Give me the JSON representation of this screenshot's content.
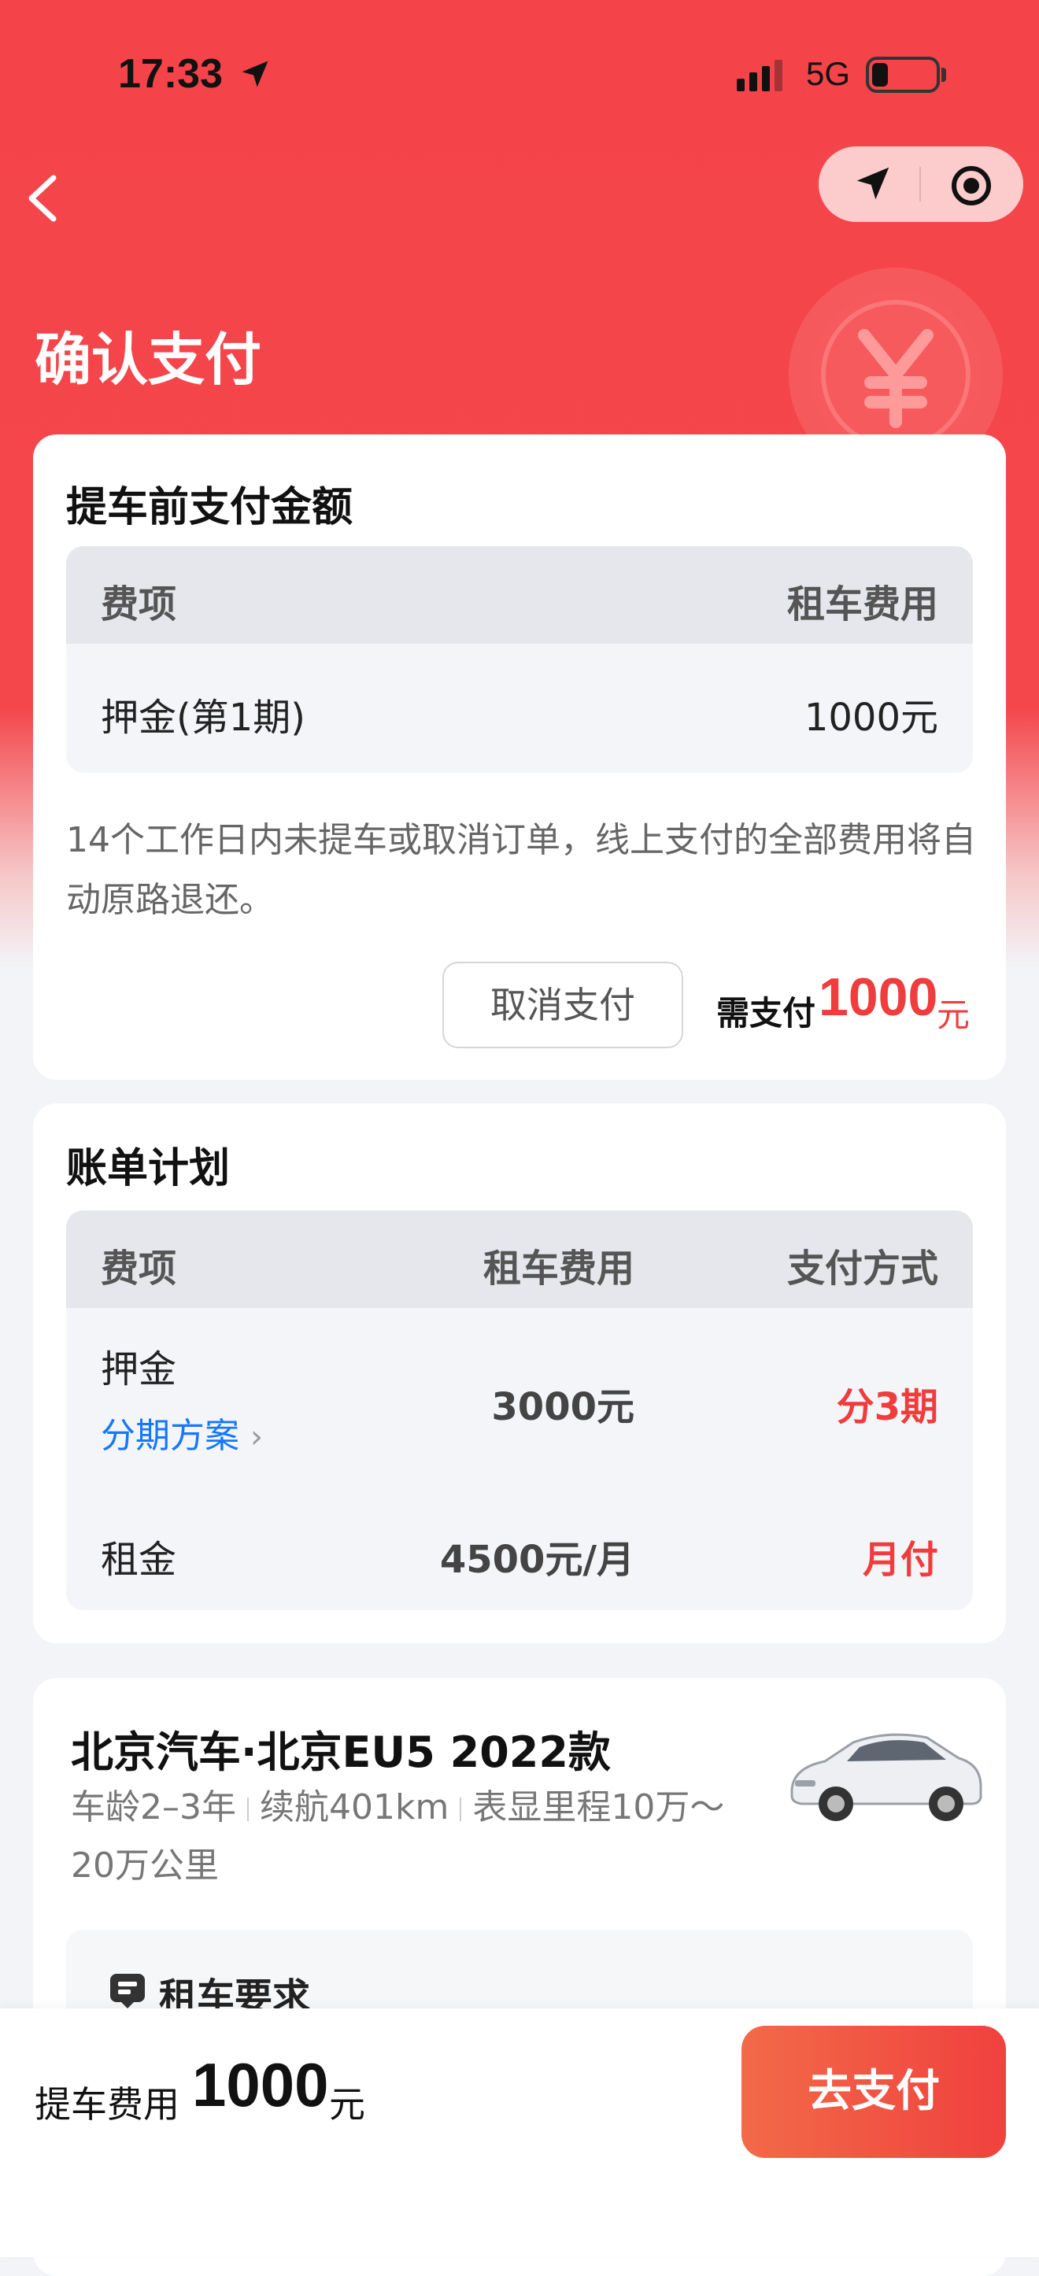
{
  "status_bar": {
    "time": "17:33",
    "network": "5G"
  },
  "header": {
    "title": "确认支付"
  },
  "pre_pickup": {
    "title": "提车前支付金额",
    "columns": [
      "费项",
      "租车费用"
    ],
    "rows": [
      {
        "item": "押金(第1期)",
        "amount": "1000元"
      }
    ],
    "note": "14个工作日内未提车或取消订单，线上支付的全部费用将自动原路退还。",
    "cancel_label": "取消支付",
    "need_pay_label": "需支付",
    "need_pay_amount": "1000",
    "need_pay_unit": "元"
  },
  "bill_plan": {
    "title": "账单计划",
    "columns": [
      "费项",
      "租车费用",
      "支付方式"
    ],
    "rows": [
      {
        "item": "押金",
        "link": "分期方案",
        "amount": "3000元",
        "method": "分3期"
      },
      {
        "item": "租金",
        "amount": "4500元/月",
        "method": "月付"
      }
    ]
  },
  "car": {
    "title": "北京汽车·北京EU5 2022款",
    "age": "车龄2–3年",
    "range": "续航401km",
    "mileage": "表显里程10万～20万公里",
    "requirements_title": "租车要求"
  },
  "bottom": {
    "fee_label": "提车费用",
    "fee_amount": "1000",
    "fee_unit": "元",
    "pay_label": "去支付"
  },
  "colors": {
    "accent": "#F4444A",
    "price_red": "#F03C3C",
    "link_blue": "#1677FF"
  }
}
